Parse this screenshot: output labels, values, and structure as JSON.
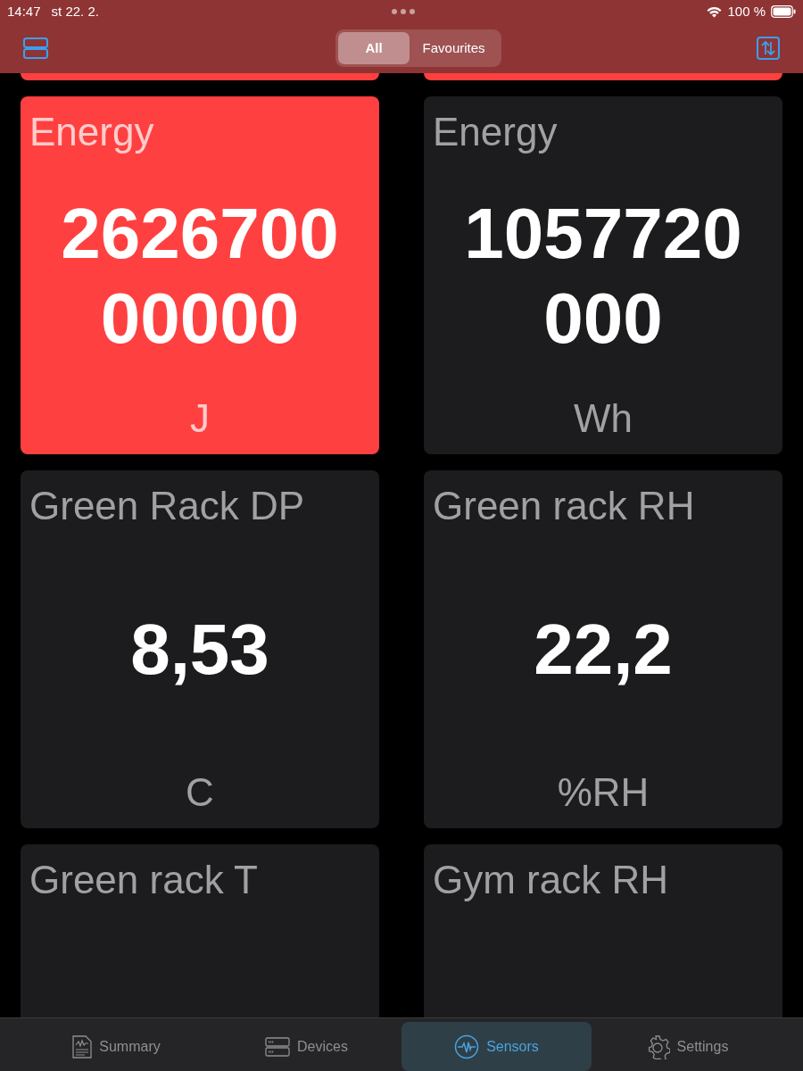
{
  "status_bar": {
    "time": "14:47",
    "date": "st 22. 2.",
    "battery": "100 %"
  },
  "segments": [
    {
      "label": "All",
      "selected": true
    },
    {
      "label": "Favourites",
      "selected": false
    }
  ],
  "cut_row": [
    {
      "alert": true
    },
    {
      "alert": true
    }
  ],
  "cards": [
    {
      "title": "Energy",
      "value": "262670000000",
      "unit": "J",
      "alert": true
    },
    {
      "title": "Energy",
      "value": "1057720000",
      "unit": "Wh",
      "alert": false
    },
    {
      "title": "Green Rack DP",
      "value": "8,53",
      "unit": "C",
      "alert": false
    },
    {
      "title": "Green rack RH",
      "value": "22,2",
      "unit": "%RH",
      "alert": false
    },
    {
      "title": "Green rack T",
      "alert": false
    },
    {
      "title": "Gym rack RH",
      "alert": false
    }
  ],
  "tab_bar": [
    {
      "label": "Summary",
      "selected": false
    },
    {
      "label": "Devices",
      "selected": false
    },
    {
      "label": "Sensors",
      "selected": true
    },
    {
      "label": "Settings",
      "selected": false
    }
  ]
}
